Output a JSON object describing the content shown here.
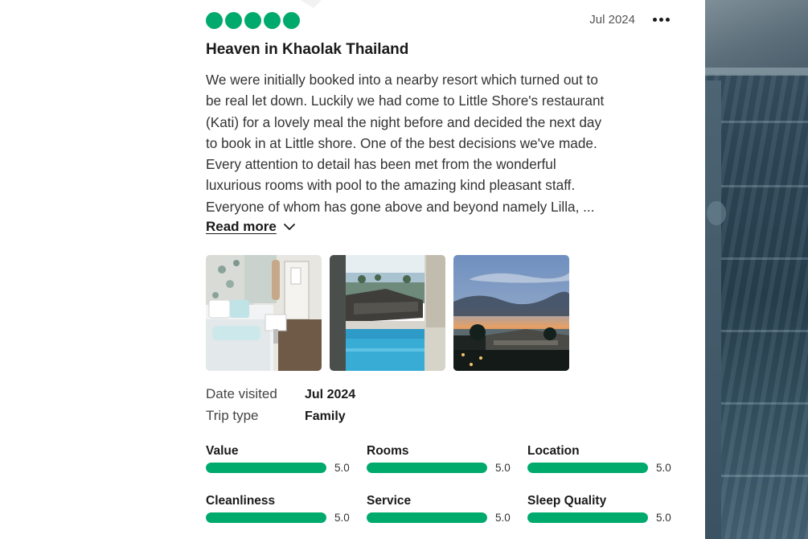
{
  "review": {
    "rating": 5,
    "date": "Jul 2024",
    "title": "Heaven in Khaolak Thailand",
    "body_lines": [
      "We were initially booked into a nearby resort which turned out to",
      "be real let down. Luckily we had come to Little Shore's restaurant",
      "(Kati) for a lovely meal the night before and decided the next day",
      "to book in at Little shore. One of the best decisions we've made.",
      "Every attention to detail has been met from the wonderful",
      "luxurious rooms with pool to the amazing kind pleasant staff.",
      "Everyone of whom has gone above and beyond namely Lilla, ..."
    ],
    "read_more": "Read more",
    "photos": [
      "hotel-room-photo",
      "pool-villa-photo",
      "sunset-resort-photo"
    ],
    "details": [
      {
        "label": "Date visited",
        "value": "Jul 2024"
      },
      {
        "label": "Trip type",
        "value": "Family"
      }
    ],
    "sub_ratings": [
      {
        "name": "Value",
        "score": "5.0",
        "fraction": 1.0
      },
      {
        "name": "Rooms",
        "score": "5.0",
        "fraction": 1.0
      },
      {
        "name": "Location",
        "score": "5.0",
        "fraction": 1.0
      },
      {
        "name": "Cleanliness",
        "score": "5.0",
        "fraction": 1.0
      },
      {
        "name": "Service",
        "score": "5.0",
        "fraction": 1.0
      },
      {
        "name": "Sleep Quality",
        "score": "5.0",
        "fraction": 1.0
      }
    ]
  },
  "icons": {
    "menu": "more-horizontal-icon",
    "read_more": "chevron-down-icon"
  },
  "colors": {
    "accent": "#00aa6c",
    "text": "#1a1a1a"
  }
}
